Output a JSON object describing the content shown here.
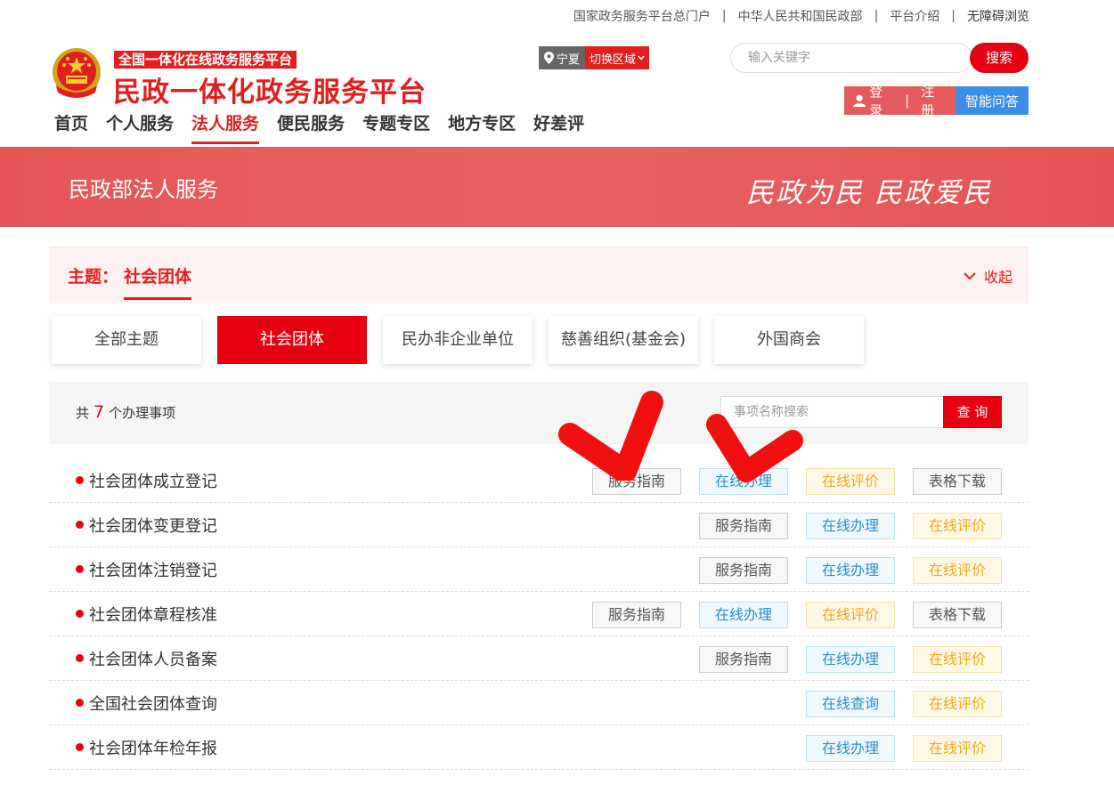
{
  "top_links": [
    "国家政务服务平台总门户",
    "中华人民共和国民政部",
    "平台介绍",
    "无障碍浏览"
  ],
  "header": {
    "subtitle": "全国一体化在线政务服务平台",
    "title": "民政一体化政务服务平台",
    "region": "宁夏",
    "switch_region": "切换区域",
    "search_placeholder": "输入关键字",
    "search_button": "搜索",
    "login": "登录",
    "register": "注册",
    "ai_qa": "智能问答"
  },
  "nav": [
    {
      "label": "首页",
      "active": false
    },
    {
      "label": "个人服务",
      "active": false
    },
    {
      "label": "法人服务",
      "active": true
    },
    {
      "label": "便民服务",
      "active": false
    },
    {
      "label": "专题专区",
      "active": false
    },
    {
      "label": "地方专区",
      "active": false
    },
    {
      "label": "好差评",
      "active": false
    }
  ],
  "banner": {
    "title": "民政部法人服务",
    "slogan": "民政为民  民政爱民"
  },
  "theme": {
    "label": "主题：",
    "value": "社会团体",
    "collapse": "收起"
  },
  "tabs": [
    {
      "label": "全部主题",
      "active": false
    },
    {
      "label": "社会团体",
      "active": true
    },
    {
      "label": "民办非企业单位",
      "active": false
    },
    {
      "label": "慈善组织(基金会)",
      "active": false
    },
    {
      "label": "外国商会",
      "active": false
    }
  ],
  "filter": {
    "count_prefix": "共",
    "count": "7",
    "count_suffix": "个办理事项",
    "search_placeholder": "事项名称搜索",
    "query_button": "查 询"
  },
  "items": [
    {
      "name": "社会团体成立登记",
      "buttons": [
        "服务指南",
        "在线办理",
        "在线评价",
        "表格下载"
      ]
    },
    {
      "name": "社会团体变更登记",
      "buttons": [
        "服务指南",
        "在线办理",
        "在线评价"
      ]
    },
    {
      "name": "社会团体注销登记",
      "buttons": [
        "服务指南",
        "在线办理",
        "在线评价"
      ]
    },
    {
      "name": "社会团体章程核准",
      "buttons": [
        "服务指南",
        "在线办理",
        "在线评价",
        "表格下载"
      ]
    },
    {
      "name": "社会团体人员备案",
      "buttons": [
        "服务指南",
        "在线办理",
        "在线评价"
      ]
    },
    {
      "name": "全国社会团体查询",
      "buttons": [
        "在线查询",
        "在线评价"
      ]
    },
    {
      "name": "社会团体年检年报",
      "buttons": [
        "在线办理",
        "在线评价"
      ]
    }
  ],
  "colors": {
    "brand_red": "#e60012",
    "banner_red": "#e55555",
    "ai_blue": "#3a8ee6",
    "arrow_red": "#f01010"
  }
}
